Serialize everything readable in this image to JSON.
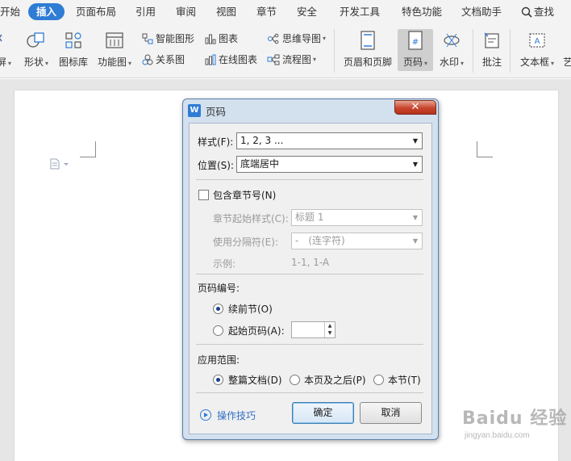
{
  "tabs": [
    "开始",
    "插入",
    "页面布局",
    "引用",
    "审阅",
    "视图",
    "章节",
    "安全",
    "开发工具",
    "特色功能",
    "文档助手"
  ],
  "search_label": "查找",
  "toolbar": {
    "screen_label": "屏",
    "shape_label": "形状",
    "icon_lib_label": "图标库",
    "func_chart_label": "功能图",
    "smart_shape_label": "智能图形",
    "chart_label": "图表",
    "mindmap_label": "思维导图",
    "relation_label": "关系图",
    "online_chart_label": "在线图表",
    "flowchart_label": "流程图",
    "header_footer_label": "页眉和页脚",
    "page_number_label": "页码",
    "watermark_label": "水印",
    "comment_label": "批注",
    "textbox_label": "文本框",
    "art_label": "艺"
  },
  "dialog": {
    "title": "页码",
    "style_label": "样式(F):",
    "style_value": "1, 2, 3 ...",
    "position_label": "位置(S):",
    "position_value": "底端居中",
    "include_chapter_label": "包含章节号(N)",
    "chapter_style_label": "章节起始样式(C):",
    "chapter_style_value": "标题 1",
    "separator_label": "使用分隔符(E):",
    "separator_value": "-　(连字符)",
    "example_label": "示例:",
    "example_value": "1-1, 1-A",
    "numbering_heading": "页码编号:",
    "continue_label": "续前节(O)",
    "start_at_label": "起始页码(A):",
    "scope_heading": "应用范围:",
    "whole_doc_label": "整篇文档(D)",
    "after_page_label": "本页及之后(P)",
    "this_section_label": "本节(T)",
    "tips_label": "操作技巧",
    "ok_label": "确定",
    "cancel_label": "取消"
  },
  "watermark_text": {
    "main": "Baidu 经验",
    "sub": "jingyan.baidu.com"
  },
  "colors": {
    "accent": "#2f7cd5",
    "dialog_frame": "#d3e0ee",
    "close_button": "#c8452e"
  }
}
